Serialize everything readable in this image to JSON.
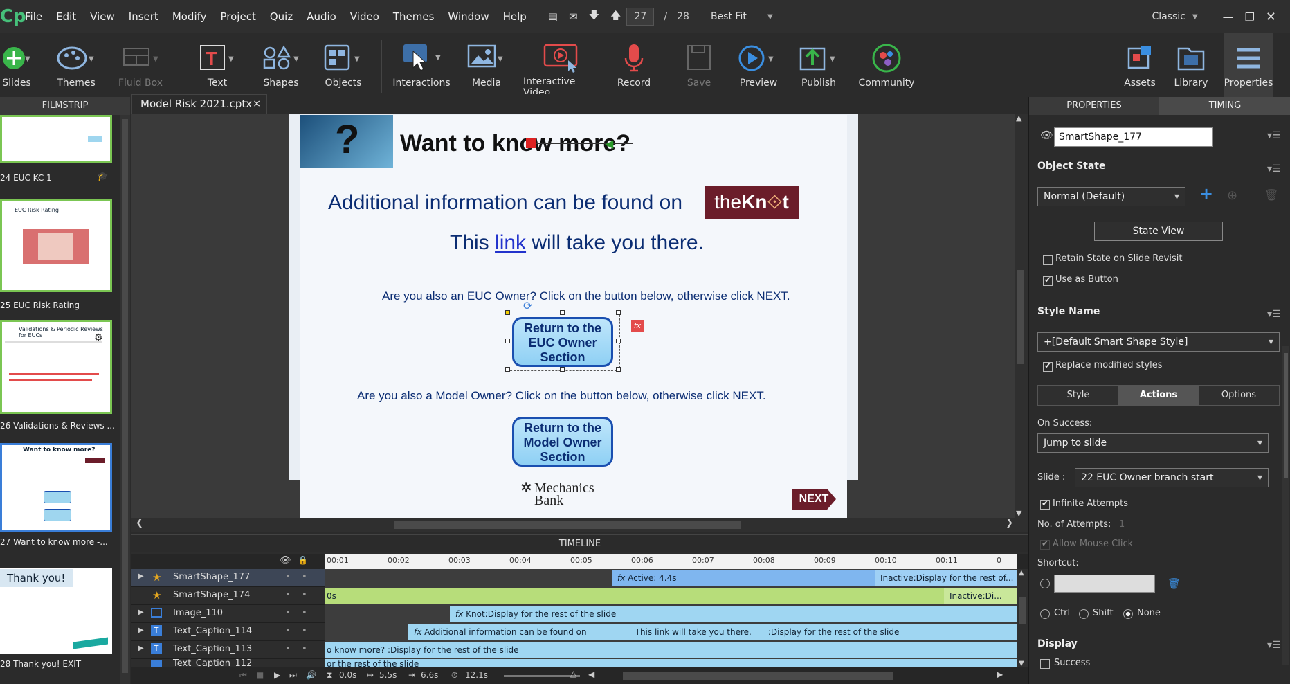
{
  "menubar": {
    "logo": "Cp",
    "items": [
      "File",
      "Edit",
      "View",
      "Insert",
      "Modify",
      "Project",
      "Quiz",
      "Audio",
      "Video",
      "Themes",
      "Window",
      "Help"
    ],
    "current_page": "27",
    "page_sep": "/",
    "total_pages": "28",
    "zoom": "Best Fit",
    "workspace": "Classic"
  },
  "toolbar": {
    "slides": "Slides",
    "themes": "Themes",
    "fluid_box": "Fluid Box",
    "text": "Text",
    "shapes": "Shapes",
    "objects": "Objects",
    "interactions": "Interactions",
    "media": "Media",
    "interactive_video": "Interactive Video",
    "record": "Record",
    "save": "Save",
    "preview": "Preview",
    "publish": "Publish",
    "community": "Community",
    "assets": "Assets",
    "library": "Library",
    "properties": "Properties"
  },
  "filmstrip": {
    "header": "FILMSTRIP",
    "thumbs": [
      {
        "label": "24 EUC KC 1"
      },
      {
        "label": "25 EUC Risk Rating"
      },
      {
        "label": "26 Validations & Reviews ..."
      },
      {
        "label": "27 Want to know more -..."
      },
      {
        "label": "28 Thank you! EXIT"
      }
    ],
    "thumb_texts": {
      "t25": "EUC Risk Rating",
      "t26": "Validations & Periodic Reviews for EUCs",
      "t27": "Want to know more?",
      "t28": "Thank you!"
    }
  },
  "tab": {
    "title": "Model Risk 2021.cptx",
    "close": "×"
  },
  "slide": {
    "heading": "Want to know more?",
    "heading_q": "?",
    "info_line": "Additional information can be found on",
    "logo_the": "the",
    "logo_knot": "Kn",
    "logo_t": "t",
    "link_pre": "This",
    "link_word": "link",
    "link_post": "will take you there.",
    "euc_question": "Are you also an EUC Owner? Click on the button below, otherwise click NEXT.",
    "euc_button": "Return to the EUC Owner Section",
    "model_question": "Are you also a Model Owner? Click on the button below, otherwise click NEXT.",
    "model_button": "Return to the Model Owner Section",
    "bank_line1": "Mechanics",
    "bank_line2": "Bank",
    "next": "NEXT",
    "fx": "fx"
  },
  "timeline": {
    "header": "TIMELINE",
    "ticks": [
      "00:01",
      "00:02",
      "00:03",
      "00:04",
      "00:05",
      "00:06",
      "00:07",
      "00:08",
      "00:09",
      "00:10",
      "00:11",
      "0"
    ],
    "rows": [
      {
        "name": "SmartShape_177",
        "bar": "Active: 4.4s",
        "bar2": "Inactive:Display for the rest of..."
      },
      {
        "name": "SmartShape_174",
        "bar": "0s",
        "bar2": "Inactive:Di..."
      },
      {
        "name": "Image_110",
        "bar": "Knot:Display for the rest of the slide"
      },
      {
        "name": "Text_Caption_114",
        "bar": "Additional information can be found on",
        "bar_b": "This link will take you there.",
        "bar_c": ":Display for the rest of the slide"
      },
      {
        "name": "Text_Caption_113",
        "bar": "o know more? :Display for the rest of the slide"
      },
      {
        "name": "Text_Caption_112",
        "bar": "or the rest of the slide"
      }
    ],
    "status": {
      "t1": "0.0s",
      "t2": "5.5s",
      "t3": "6.6s",
      "t4": "12.1s"
    }
  },
  "props": {
    "tab_properties": "PROPERTIES",
    "tab_timing": "TIMING",
    "object_name": "SmartShape_177",
    "object_state": "Object State",
    "state_value": "Normal (Default)",
    "state_view": "State View",
    "retain": "Retain State on Slide Revisit",
    "use_as_button": "Use as Button",
    "style_name": "Style Name",
    "style_value": "+[Default Smart Shape Style]",
    "replace": "Replace modified styles",
    "subtabs": [
      "Style",
      "Actions",
      "Options"
    ],
    "on_success": "On Success:",
    "on_success_value": "Jump to slide",
    "slide_label": "Slide :",
    "slide_value": "22 EUC Owner branch start",
    "infinite": "Infinite Attempts",
    "attempts": "No. of Attempts:",
    "attempts_value": "1",
    "allow_mouse": "Allow Mouse Click",
    "shortcut": "Shortcut:",
    "ctrl": "Ctrl",
    "shift": "Shift",
    "none": "None",
    "display": "Display",
    "success": "Success"
  }
}
